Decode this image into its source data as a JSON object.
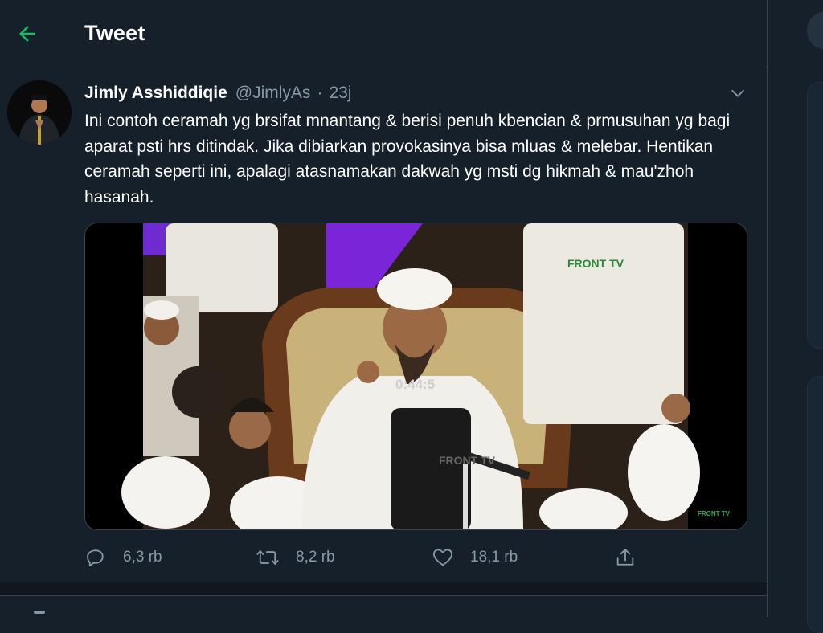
{
  "header": {
    "title": "Tweet",
    "back_icon": "arrow-left-icon"
  },
  "tweet": {
    "author_name": "Jimly Asshiddiqie",
    "author_handle": "@JimlyAs",
    "separator": "·",
    "time": "23j",
    "text": "Ini contoh ceramah yg brsifat mnantang & berisi penuh kbencian & prmusuhan yg bagi aparat psti hrs ditindak. Jika dibiarkan provokasinya bisa mluas & melebar. Hentikan ceramah seperti ini, apalagi atasnamakan dakwah yg msti dg hikmah & mau'zhoh hasanah.",
    "video_watermark": "FRONT TV",
    "video_timestamp": "0:44:5"
  },
  "actions": {
    "reply_count": "6,3 rb",
    "retweet_count": "8,2 rb",
    "like_count": "18,1 rb"
  },
  "colors": {
    "background": "#15202b",
    "accent": "#1da1f2",
    "back_arrow": "#17bf63",
    "secondary_text": "#8899a6",
    "border": "#38444d"
  }
}
